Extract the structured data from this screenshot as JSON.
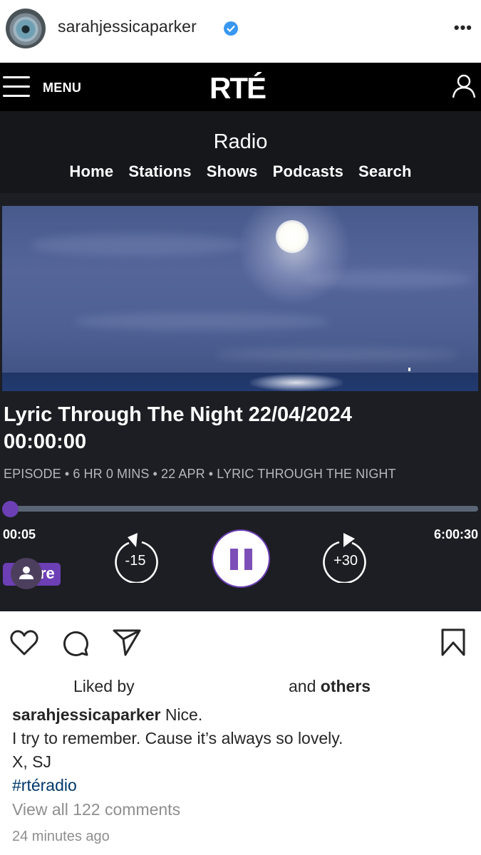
{
  "post": {
    "username": "sarahjessicaparker",
    "verified": true,
    "more_icon": "more-horizontal-icon"
  },
  "rte": {
    "menu_label": "MENU",
    "logo": "RTÉ",
    "section_title": "Radio",
    "nav": [
      "Home",
      "Stations",
      "Shows",
      "Podcasts",
      "Search"
    ]
  },
  "player": {
    "title_line1": "Lyric Through The Night 22/04/2024",
    "title_line2": "00:00:00",
    "meta": "EPISODE • 6 HR 0 MINS • 22 APR • LYRIC THROUGH THE NIGHT",
    "current_time": "00:05",
    "total_time": "6:00:30",
    "progress_fraction": 0.0002,
    "skip_back_label": "-15",
    "skip_forward_label": "+30",
    "state": "playing",
    "share_label_partial": "re",
    "accent_color": "#6c3fb5"
  },
  "engagement": {
    "liked_by": "Liked by",
    "and": "and",
    "others": "others"
  },
  "caption": {
    "username": "sarahjessicaparker",
    "line1": "Nice.",
    "line2": "I try to remember. Cause it’s always so lovely.",
    "line3": "X, SJ",
    "hashtag": "#rtéradio"
  },
  "comments": {
    "view_all": "View all 122 comments"
  },
  "timestamp": "24 minutes ago"
}
